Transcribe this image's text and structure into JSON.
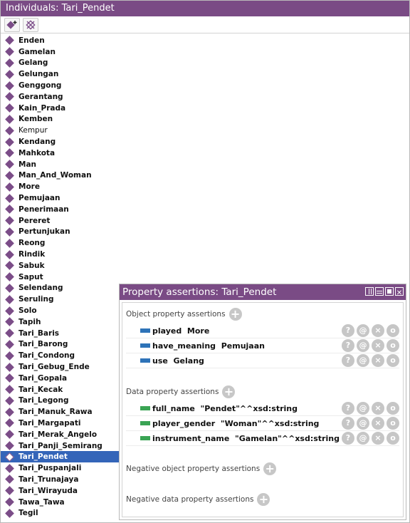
{
  "individuals_panel": {
    "title": "Individuals: Tari_Pendet",
    "toolbar": {
      "add_icon": "add-individual-icon",
      "delete_icon": "delete-individual-icon"
    },
    "items": [
      {
        "label": "Enden"
      },
      {
        "label": "Gamelan"
      },
      {
        "label": "Gelang"
      },
      {
        "label": "Gelungan"
      },
      {
        "label": "Genggong"
      },
      {
        "label": "Gerantang"
      },
      {
        "label": "Kain_Prada"
      },
      {
        "label": "Kemben"
      },
      {
        "label": "Kempur",
        "normal": true
      },
      {
        "label": "Kendang"
      },
      {
        "label": "Mahkota"
      },
      {
        "label": "Man"
      },
      {
        "label": "Man_And_Woman"
      },
      {
        "label": "More"
      },
      {
        "label": "Pemujaan"
      },
      {
        "label": "Penerimaan"
      },
      {
        "label": "Pereret"
      },
      {
        "label": "Pertunjukan"
      },
      {
        "label": "Reong"
      },
      {
        "label": "Rindik"
      },
      {
        "label": "Sabuk"
      },
      {
        "label": "Saput"
      },
      {
        "label": "Selendang"
      },
      {
        "label": "Seruling"
      },
      {
        "label": "Solo"
      },
      {
        "label": "Tapih"
      },
      {
        "label": "Tari_Baris"
      },
      {
        "label": "Tari_Barong"
      },
      {
        "label": "Tari_Condong"
      },
      {
        "label": "Tari_Gebug_Ende"
      },
      {
        "label": "Tari_Gopala"
      },
      {
        "label": "Tari_Kecak"
      },
      {
        "label": "Tari_Legong"
      },
      {
        "label": "Tari_Manuk_Rawa"
      },
      {
        "label": "Tari_Margapati"
      },
      {
        "label": "Tari_Merak_Angelo"
      },
      {
        "label": "Tari_Panji_Semirang"
      },
      {
        "label": "Tari_Pendet",
        "selected": true
      },
      {
        "label": "Tari_Puspanjali"
      },
      {
        "label": "Tari_Trunajaya"
      },
      {
        "label": "Tari_Wirayuda"
      },
      {
        "label": "Tawa_Tawa"
      },
      {
        "label": "Tegil"
      }
    ]
  },
  "property_panel": {
    "title": "Property assertions: Tari_Pendet",
    "sections": {
      "object": {
        "heading": "Object property assertions",
        "rows": [
          {
            "property": "played",
            "value": "More"
          },
          {
            "property": "have_meaning",
            "value": "Pemujaan"
          },
          {
            "property": "use",
            "value": "Gelang"
          }
        ]
      },
      "data": {
        "heading": "Data property assertions",
        "rows": [
          {
            "property": "full_name",
            "value": "\"Pendet\"^^xsd:string"
          },
          {
            "property": "player_gender",
            "value": "\"Woman\"^^xsd:string"
          },
          {
            "property": "instrument_name",
            "value": "\"Gamelan\"^^xsd:string"
          }
        ]
      },
      "negative_object": {
        "heading": "Negative object property assertions"
      },
      "negative_data": {
        "heading": "Negative data property assertions"
      }
    },
    "row_buttons": [
      "?",
      "@",
      "×",
      "o"
    ]
  },
  "colors": {
    "title_bar": "#7a4b85",
    "selection": "#3465b9",
    "object_property": "#2e73b8",
    "data_property": "#3aa454"
  }
}
